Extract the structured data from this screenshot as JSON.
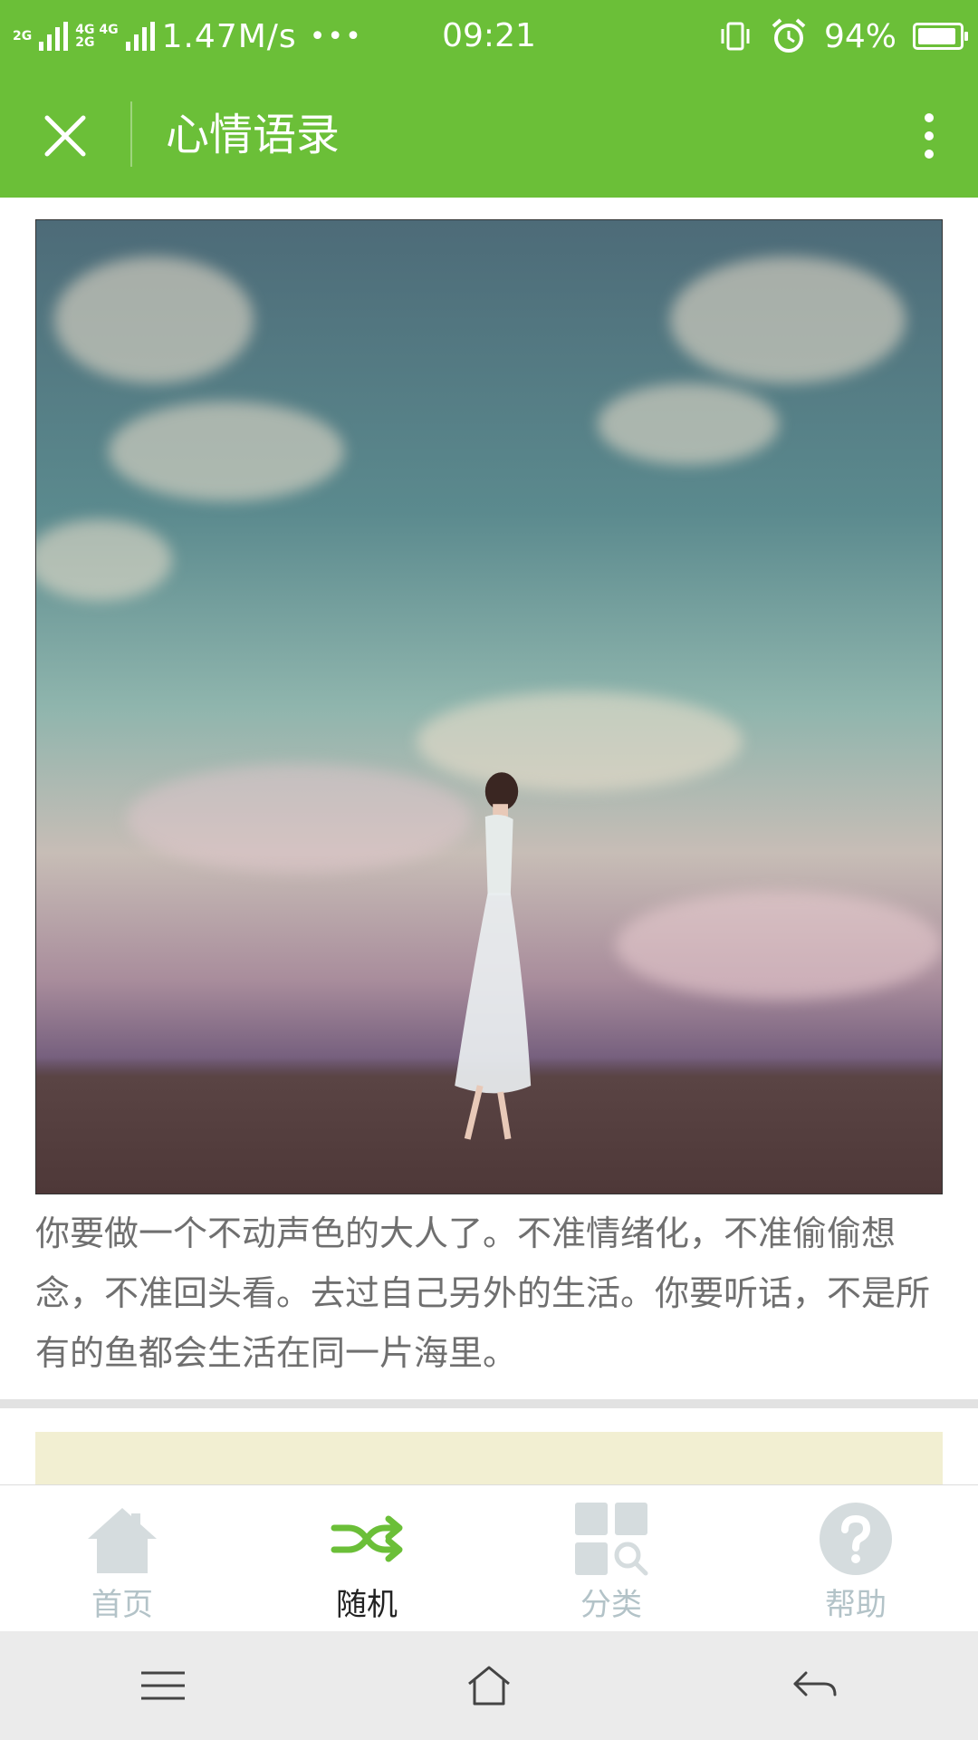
{
  "status_bar": {
    "net_top": "2G",
    "net_mid": "4G 4G",
    "net_bot": "2G",
    "speed": "1.47M/s",
    "more": "•••",
    "time": "09:21",
    "battery": "94%",
    "battery_level": 0.94
  },
  "title_bar": {
    "title": "心情语录"
  },
  "cards": [
    {
      "quote": "你要做一个不动声色的大人了。不准情绪化，不准偷偷想念，不准回头看。去过自己另外的生活。你要听话，不是所有的鱼都会生活在同一片海里。"
    }
  ],
  "bottom_nav": {
    "items": [
      {
        "label": "首页",
        "icon": "home-icon"
      },
      {
        "label": "随机",
        "icon": "shuffle-icon"
      },
      {
        "label": "分类",
        "icon": "category-search-icon"
      },
      {
        "label": "帮助",
        "icon": "help-icon"
      }
    ],
    "active_color": "#6bbf38",
    "inactive_color": "#d5dcde"
  },
  "colors": {
    "accent": "#6bbf38"
  }
}
